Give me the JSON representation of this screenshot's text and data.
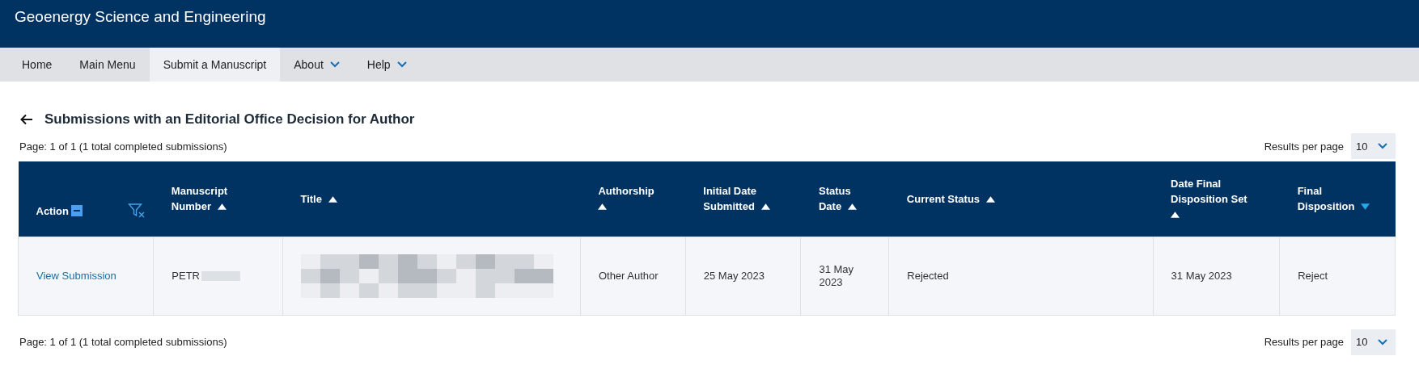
{
  "header": {
    "journal_title": "Geoenergy Science and Engineering"
  },
  "nav": [
    {
      "label": "Home",
      "selected": false,
      "has_menu": false
    },
    {
      "label": "Main Menu",
      "selected": false,
      "has_menu": false
    },
    {
      "label": "Submit a Manuscript",
      "selected": true,
      "has_menu": false
    },
    {
      "label": "About",
      "selected": false,
      "has_menu": true
    },
    {
      "label": "Help",
      "selected": false,
      "has_menu": true
    }
  ],
  "heading": "Submissions with an Editorial Office Decision for Author",
  "page_info_top": "Page: 1 of 1 (1 total completed submissions)",
  "results_per_page_top": {
    "label": "Results per page",
    "value": "10"
  },
  "table": {
    "columns": [
      {
        "label": "Action",
        "kind": "action"
      },
      {
        "label": "Manuscript Number",
        "sort_descending": false
      },
      {
        "label": "Title",
        "sort_descending": false
      },
      {
        "label": "Authorship",
        "sort_descending": false
      },
      {
        "label": "Initial Date Submitted",
        "sort_descending": false
      },
      {
        "label": "Status Date",
        "sort_descending": false
      },
      {
        "label": "Current Status",
        "sort_descending": false
      },
      {
        "label": "Date Final Disposition Set",
        "sort_descending": false
      },
      {
        "label": "Final Disposition",
        "sort_descending": true
      }
    ],
    "rows": [
      {
        "action": "View Submission",
        "manuscript_number": "PETR",
        "authorship": "Other Author",
        "initial_date_submitted": "25 May 2023",
        "status_date": "31 May 2023",
        "current_status": "Rejected",
        "date_final_disposition_set": "31 May 2023",
        "final_disposition": "Reject"
      }
    ]
  },
  "page_info_bottom": "Page: 1 of 1 (1 total completed submissions)",
  "results_per_page_bottom": {
    "label": "Results per page",
    "value": "10"
  }
}
